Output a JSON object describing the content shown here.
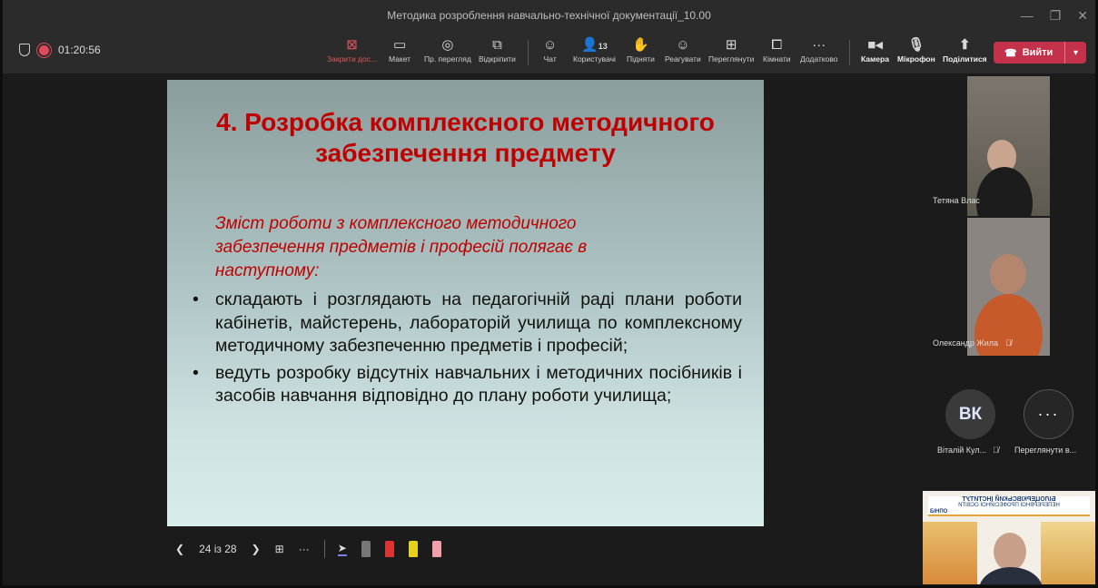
{
  "window": {
    "title": "Методика розроблення навчально-технічної документації_10.00"
  },
  "recording": {
    "timer": "01:20:56"
  },
  "toolbar": {
    "close_share": "Закрити дос...",
    "layout": "Макет",
    "view": "Пр. перегляд",
    "detach": "Відкріпити",
    "chat": "Чат",
    "people": "Користувачі",
    "people_count": "13",
    "raise": "Підняти",
    "react": "Реагувати",
    "views": "Переглянути",
    "rooms": "Кімнати",
    "more": "Додатково",
    "camera": "Камера",
    "mic": "Мікрофон",
    "share": "Поділитися",
    "leave": "Вийти"
  },
  "slide": {
    "title": "4. Розробка комплексного методичного забезпечення предмету",
    "intro": "Зміст роботи з комплексного методичного забезпечення предметів і професій полягає в наступному:",
    "bullets": [
      "складають і розглядають на педагогічній раді плани роботи кабінетів, майстерень, лабораторій училища по комплексному методичному забезпеченню предметів і професій;",
      "ведуть розробку відсутніх навчальних і методичних посібників і засобів навчання відповідно до плану роботи училища;"
    ]
  },
  "presenter": {
    "page": "24 із 28"
  },
  "participants": {
    "p1": "Тетяна Влас",
    "p2": "Олександр Жила",
    "p3_initials": "ВК",
    "p3": "Віталій Кул...",
    "view_more": "Переглянути в..."
  },
  "banner": {
    "line1": "БІЛОЦЕРКІВСЬКИЙ ІНСТИТУТ",
    "line2": "НЕПЕРЕРВНОЇ ПРОФЕСІЙНОЇ ОСВІТИ",
    "logo": "БІНПО"
  }
}
